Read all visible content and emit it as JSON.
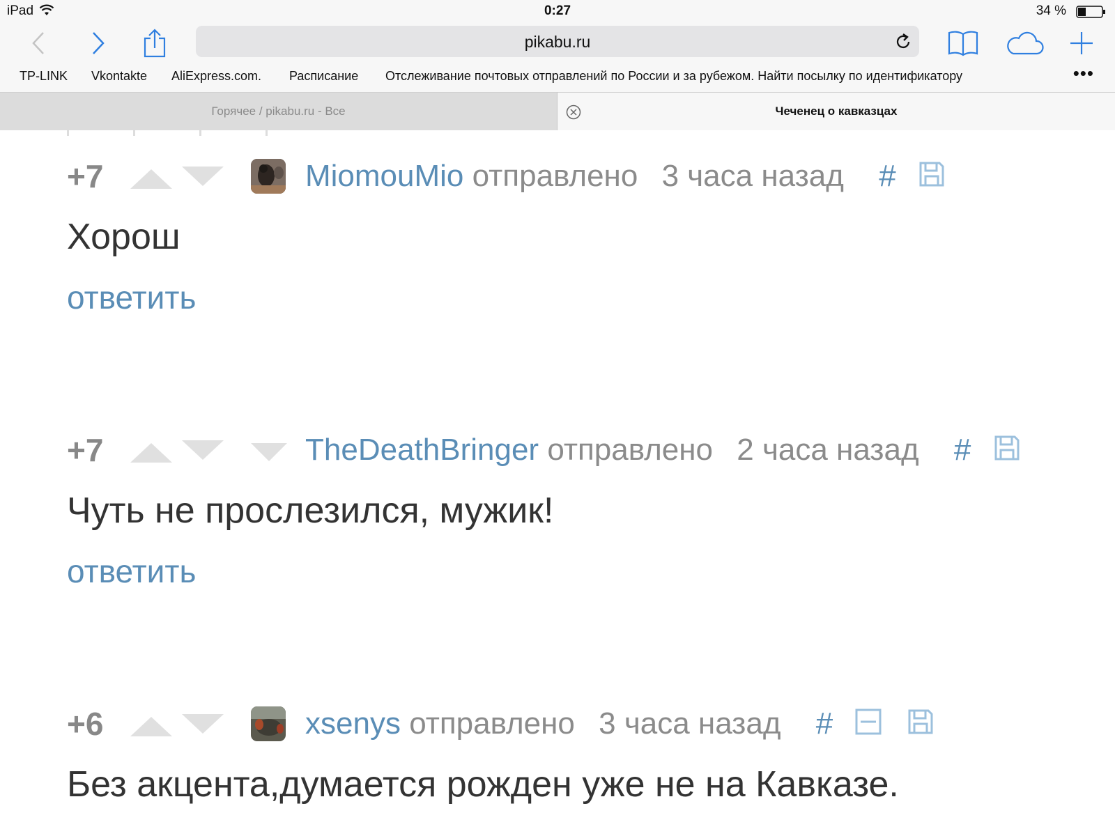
{
  "status_bar": {
    "device": "iPad",
    "time": "0:27",
    "battery": "34 %"
  },
  "browser": {
    "url": "pikabu.ru",
    "bookmarks": [
      "TP-LINK",
      "Vkontakte",
      "AliExpress.com.",
      "Расписание",
      "Отслеживание почтовых отправлений по России и за рубежом. Найти посылку по идентификатору"
    ],
    "more_label": "•••",
    "tabs": [
      {
        "title": "Горячее / pikabu.ru - Все",
        "active": false
      },
      {
        "title": "Чеченец о кавказцах",
        "active": true
      }
    ]
  },
  "comments": [
    {
      "score": "+7",
      "author": "MiomouMio",
      "sent_label": "отправлено",
      "time": "3 часа назад",
      "hash": "#",
      "text": "Хорош",
      "reply_label": "ответить",
      "has_avatar": true
    },
    {
      "score": "+7",
      "author": "TheDeathBringer",
      "sent_label": "отправлено",
      "time": "2 часа назад",
      "hash": "#",
      "text": "Чуть не прослезился, мужик!",
      "reply_label": "ответить",
      "has_avatar": false
    },
    {
      "score": "+6",
      "author": "xsenys",
      "sent_label": "отправлено",
      "time": "3 часа назад",
      "hash": "#",
      "text": "Без акцента,думается рожден уже не на Кавказе.",
      "has_avatar": true
    }
  ],
  "colors": {
    "link": "#5a8db6",
    "muted": "#8b8b8b",
    "ios_blue": "#2f7fe0"
  },
  "icons": [
    "back-icon",
    "forward-icon",
    "share-icon",
    "reload-icon",
    "bookmarks-book-icon",
    "icloud-tabs-icon",
    "new-tab-plus-icon",
    "tab-close-icon",
    "upvote-arrow-icon",
    "downvote-arrow-icon",
    "save-floppy-icon",
    "collapse-minus-icon"
  ]
}
